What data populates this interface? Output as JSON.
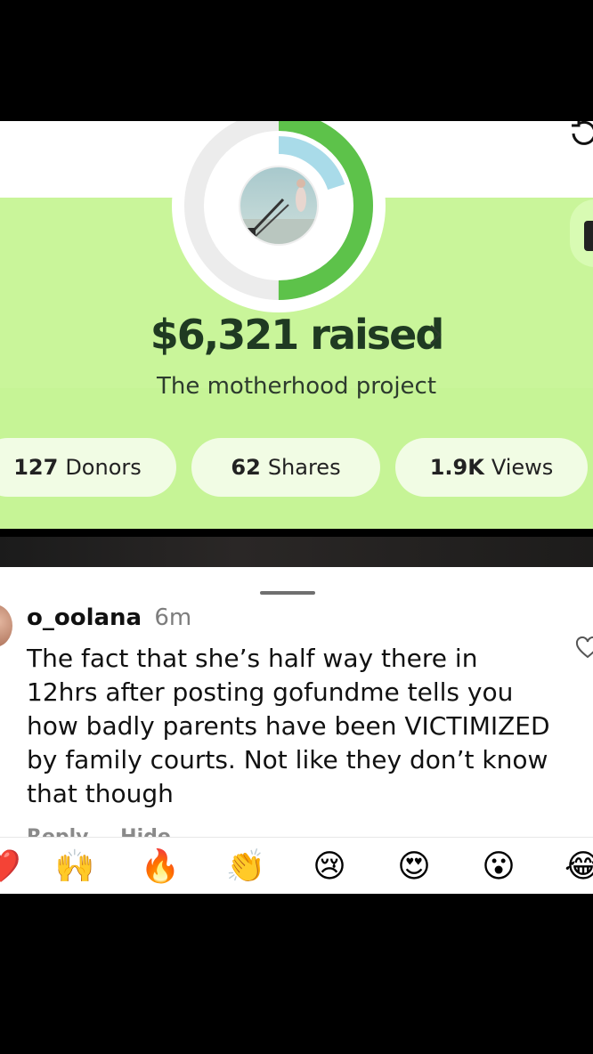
{
  "fundraiser": {
    "amount": "$6,321 raised",
    "title": "The motherhood project",
    "progress_fraction": 0.5,
    "stats": {
      "donors_count": "127",
      "donors_label": "Donors",
      "shares_count": "62",
      "shares_label": "Shares",
      "views_count": "1.9K",
      "views_label": "Views"
    },
    "colors": {
      "band": "#c9f59a",
      "ring_green": "#5dc24a",
      "ring_blue": "#9fd7e6",
      "text_dark": "#1f3a22"
    }
  },
  "comment": {
    "username": "o_oolana",
    "time": "6m",
    "text": "The fact that she’s half way there in 12hrs after posting gofundme tells you how badly parents have been VICTIMIZED by family courts. Not like they don’t know that though",
    "actions": {
      "reply": "Reply",
      "hide": "Hide"
    }
  },
  "emoji_bar": {
    "emojis": [
      "❤️",
      "🙌",
      "🔥",
      "👏",
      "😢",
      "😍",
      "😮",
      "😂"
    ]
  },
  "icons": [
    "refresh-icon",
    "chevron-right-icon",
    "heart-outline-icon",
    "avatar"
  ]
}
